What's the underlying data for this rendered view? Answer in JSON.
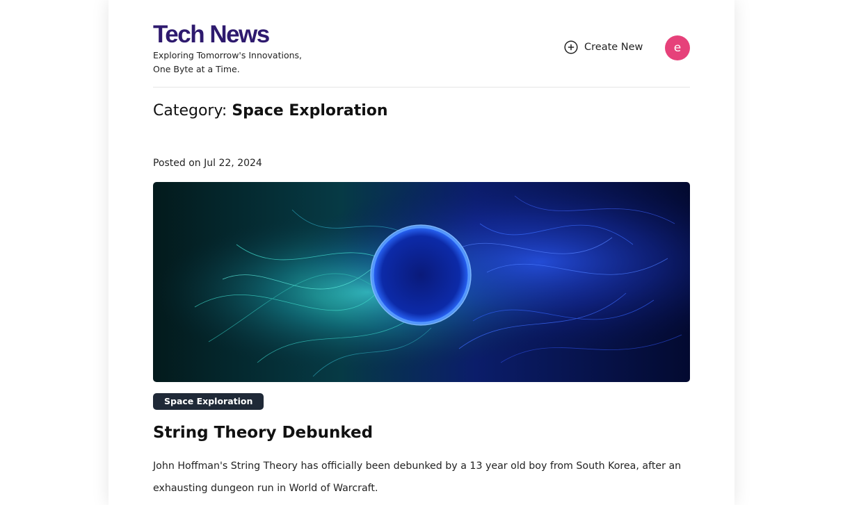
{
  "brand": {
    "title": "Tech News",
    "tagline_line1": "Exploring Tomorrow's Innovations,",
    "tagline_line2": "One Byte at a Time."
  },
  "header": {
    "create_new_label": "Create New",
    "create_new_icon": "plus-circle-icon",
    "avatar_letter": "e",
    "avatar_color": "#e6417a",
    "brand_color": "#2e1a6e"
  },
  "category": {
    "prefix": "Category:",
    "name": "Space Exploration"
  },
  "post": {
    "date": "Posted on Jul 22, 2024",
    "image_description": "glowing-blue-ring-with-strings",
    "tag": "Space Exploration",
    "tag_color": "#1f2937",
    "title": "String Theory Debunked",
    "excerpt": "John Hoffman's String Theory has officially been debunked by a 13 year old boy from South Korea, after an exhausting dungeon run in World of Warcraft."
  }
}
